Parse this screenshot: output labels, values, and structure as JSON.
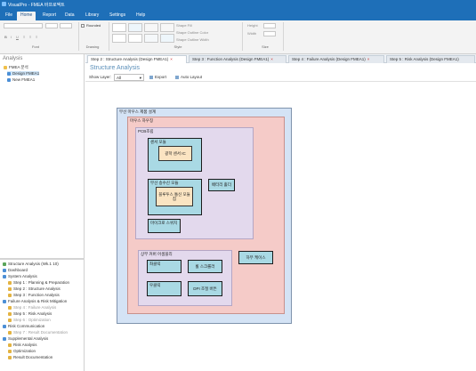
{
  "app": {
    "title": "VisualPro - FMEA 바프로젝트"
  },
  "ribbon_tabs": [
    "File",
    "Home",
    "Report",
    "Data",
    "Library",
    "Settings",
    "Help"
  ],
  "ribbon": {
    "groups": [
      "Font",
      "Drawing",
      "Style",
      "Size"
    ],
    "drawing_label": "Rounded",
    "style_items": [
      "Shape Fill",
      "Shape Outline Color",
      "Shape Outline Width"
    ],
    "size_items": [
      "Height",
      "Width"
    ]
  },
  "left_pane": {
    "title": "Analysis",
    "tree": [
      {
        "label": "FMEA 분석",
        "icon": "folder-icon",
        "selected": false
      },
      {
        "label": "Design FMEA1",
        "icon": "doc-icon",
        "selected": true
      },
      {
        "label": "New FMEA1",
        "icon": "doc-icon",
        "selected": false
      }
    ],
    "steps": [
      {
        "label": "Structure Analysis (Wk.1 10)",
        "icon": "green-dot",
        "dim": false
      },
      {
        "label": "Dashboard",
        "icon": "blue-dot",
        "dim": false
      },
      {
        "label": "System Analysis",
        "icon": "blue-dot",
        "dim": false
      },
      {
        "label": "Step 1 : Planning & Preparation",
        "icon": "yellow-dot",
        "dim": false
      },
      {
        "label": "Step 2 : Structure Analysis",
        "icon": "yellow-dot",
        "dim": false
      },
      {
        "label": "Step 3 : Function Analysis",
        "icon": "yellow-dot",
        "dim": false
      },
      {
        "label": "Failure Analysis & Risk Mitigation",
        "icon": "blue-dot",
        "dim": false
      },
      {
        "label": "Step 4 : Failure Analysis",
        "icon": "yellow-dot",
        "dim": true
      },
      {
        "label": "Step 5 : Risk Analysis",
        "icon": "yellow-dot",
        "dim": false
      },
      {
        "label": "Step 6 : Optimization",
        "icon": "yellow-dot",
        "dim": true
      },
      {
        "label": "Risk Communication",
        "icon": "blue-dot",
        "dim": false
      },
      {
        "label": "Step 7 : Result Documentation",
        "icon": "yellow-dot",
        "dim": true
      },
      {
        "label": "Supplemental Analysis",
        "icon": "blue-dot",
        "dim": false
      },
      {
        "label": "Risk Analysis",
        "icon": "yellow-dot",
        "dim": false
      },
      {
        "label": "Optimization",
        "icon": "yellow-dot",
        "dim": false
      },
      {
        "label": "Result Documentation",
        "icon": "yellow-dot",
        "dim": false
      }
    ]
  },
  "doc_tabs": [
    {
      "label": "Step 2 : Structure Analysis (Design FMEA1)",
      "active": true
    },
    {
      "label": "Step 3 : Function Analysis (Design FMEA1)",
      "active": false
    },
    {
      "label": "Step 4 : Failure Analysis (Design FMEA1)",
      "active": false
    },
    {
      "label": "Step 5 : Risk Analysis (Design FMEA1)",
      "active": false
    }
  ],
  "main": {
    "title": "Structure Analysis",
    "show_layer_label": "Show Layer:",
    "show_layer_value": "All",
    "export_label": "Export",
    "auto_layout_label": "Auto Layout"
  },
  "diagram": {
    "outer": "무선 마우스 제품 설계",
    "pink": "마우스 하우징",
    "lavender": "PCB조립",
    "b1_outer": "센서 모듈",
    "b1_inner": "광학 센서 IC",
    "b2_outer": "무선 송수신 모듈",
    "b2_inner": "블루투스 통신 모듈 칩",
    "b3": "배터리 홀더",
    "b4": "마이크로 스위치",
    "lower": "상부 커버 어셈블리",
    "c1": "좌클릭",
    "c2": "휠 스크롤러",
    "c3": "우클릭",
    "c4": "DPI 조절 버튼",
    "side": "하부 케이스"
  }
}
